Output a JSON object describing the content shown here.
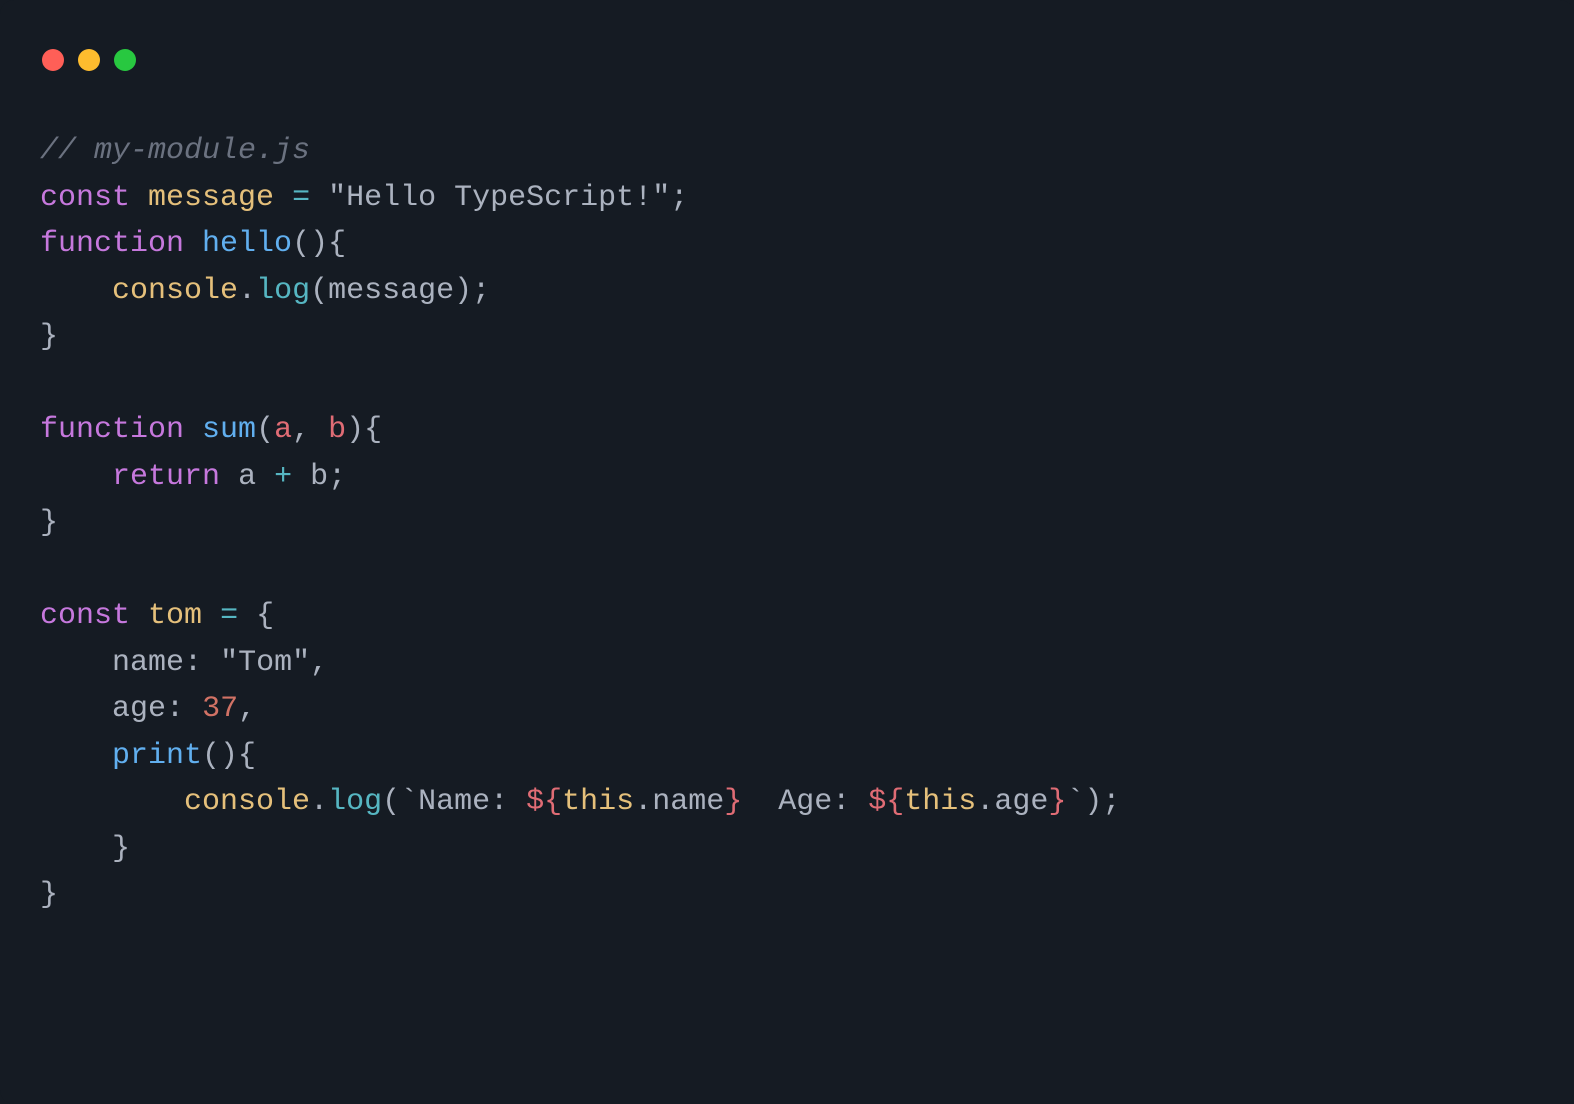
{
  "window": {
    "traffic_lights": {
      "close": "#ff5f57",
      "minimize": "#febc2e",
      "zoom": "#28c840"
    }
  },
  "code": {
    "line1": {
      "comment": "// my-module.js"
    },
    "line2": {
      "kw_const": "const",
      "sp1": " ",
      "ident_message": "message",
      "sp2": " ",
      "eq": "=",
      "sp3": " ",
      "str_open": "\"",
      "str_body": "Hello TypeScript!",
      "str_close": "\"",
      "semi": ";"
    },
    "line3": {
      "kw_function": "function",
      "sp1": " ",
      "ident_hello": "hello",
      "paren": "(){"
    },
    "line4": {
      "indent": "    ",
      "console": "console",
      "dot": ".",
      "log": "log",
      "open": "(",
      "arg": "message",
      "close": ");"
    },
    "line5": {
      "brace": "}"
    },
    "line6": {
      "blank": ""
    },
    "line7": {
      "kw_function": "function",
      "sp1": " ",
      "ident_sum": "sum",
      "open": "(",
      "a": "a",
      "comma": ",",
      "sp2": " ",
      "b": "b",
      "close": "){"
    },
    "line8": {
      "indent": "    ",
      "kw_return": "return",
      "sp1": " ",
      "a": "a",
      "sp2": " ",
      "plus": "+",
      "sp3": " ",
      "b": "b",
      "semi": ";"
    },
    "line9": {
      "brace": "}"
    },
    "line10": {
      "blank": ""
    },
    "line11": {
      "kw_const": "const",
      "sp1": " ",
      "ident_tom": "tom",
      "sp2": " ",
      "eq": "=",
      "sp3": " ",
      "brace": "{"
    },
    "line12": {
      "indent": "    ",
      "key_name": "name",
      "colon": ":",
      "sp1": " ",
      "str_open": "\"",
      "str_body": "Tom",
      "str_close": "\"",
      "comma": ","
    },
    "line13": {
      "indent": "    ",
      "key_age": "age",
      "colon": ":",
      "sp1": " ",
      "num": "37",
      "comma": ","
    },
    "line14": {
      "indent": "    ",
      "method_print": "print",
      "paren": "(){"
    },
    "line15": {
      "indent": "        ",
      "console": "console",
      "dot": ".",
      "log": "log",
      "open": "(",
      "btick1": "`",
      "txt1": "Name: ",
      "dopen1": "${",
      "this1": "this",
      "dot1": ".",
      "prop1": "name",
      "dclose1": "}",
      "txt2": "  Age: ",
      "dopen2": "${",
      "this2": "this",
      "dot2": ".",
      "prop2": "age",
      "dclose2": "}",
      "btick2": "`",
      "close": ");"
    },
    "line16": {
      "indent": "    ",
      "brace": "}"
    },
    "line17": {
      "brace": "}"
    }
  }
}
